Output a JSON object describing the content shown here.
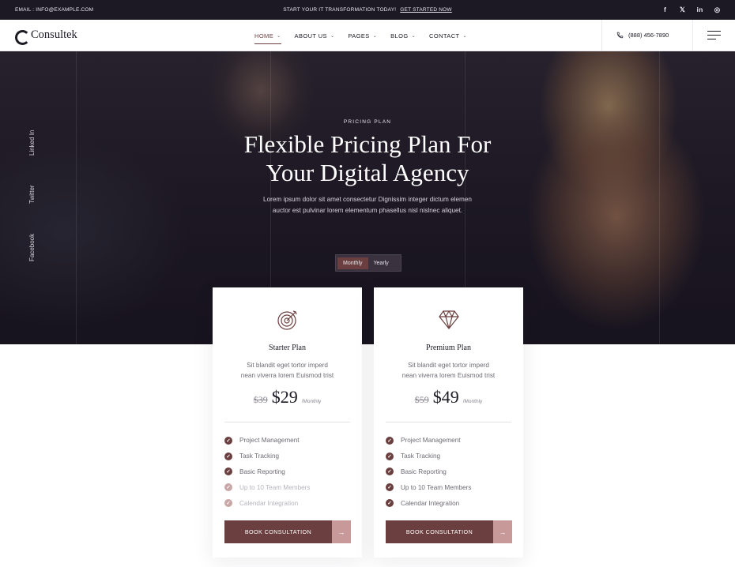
{
  "topbar": {
    "email": "EMAIL : INFO@EXAMPLE.COM",
    "promo_text": "START YOUR IT TRANSFORMATION TODAY!",
    "promo_link": "GET STARTED NOW",
    "social": [
      "f",
      "𝕏",
      "in",
      "◎"
    ]
  },
  "nav": {
    "brand": "Consultek",
    "menu": [
      {
        "label": "HOME"
      },
      {
        "label": "ABOUT US"
      },
      {
        "label": "PAGES"
      },
      {
        "label": "BLOG"
      },
      {
        "label": "CONTACT"
      }
    ],
    "active_index": 0,
    "phone": "(888) 456-7890"
  },
  "hero": {
    "side_social": [
      "Linked In",
      "Twitter",
      "Facebook"
    ],
    "kicker": "PRICING PLAN",
    "title_line1": "Flexible Pricing Plan For",
    "title_line2": "Your Digital Agency",
    "desc_line1": "Lorem ipsum dolor sit amet consectetur Dignissim integer dictum elemen",
    "desc_line2": "auctor est pulvinar lorem elementum phasellus nisl nislnec aliquet.",
    "toggle": {
      "monthly": "Monthly",
      "yearly": "Yearly",
      "selected": "Monthly"
    }
  },
  "plans": [
    {
      "icon": "target-icon",
      "name": "Starter Plan",
      "desc_line1": "Sit blandit eget tortor imperd",
      "desc_line2": "nean viverra lorem Euismod trist",
      "old_price": "$39",
      "price": "$29",
      "period": "/Monthly",
      "features": [
        {
          "label": "Project Management",
          "included": true
        },
        {
          "label": "Task Tracking",
          "included": true
        },
        {
          "label": "Basic Reporting",
          "included": true
        },
        {
          "label": "Up to 10 Team Members",
          "included": false
        },
        {
          "label": "Calendar Integration",
          "included": false
        }
      ],
      "button": "BOOK CONSULTATION"
    },
    {
      "icon": "diamond-icon",
      "name": "Premium Plan",
      "desc_line1": "Sit blandit eget tortor imperd",
      "desc_line2": "nean viverra lorem Euismod trist",
      "old_price": "$59",
      "price": "$49",
      "period": "/Monthly",
      "features": [
        {
          "label": "Project Management",
          "included": true
        },
        {
          "label": "Task Tracking",
          "included": true
        },
        {
          "label": "Basic Reporting",
          "included": true
        },
        {
          "label": "Up to 10 Team Members",
          "included": true
        },
        {
          "label": "Calendar Integration",
          "included": true
        }
      ],
      "button": "BOOK CONSULTATION"
    }
  ],
  "colors": {
    "accent": "#6b3f3f",
    "accent_light": "#c79999",
    "dark": "#1c1824"
  }
}
